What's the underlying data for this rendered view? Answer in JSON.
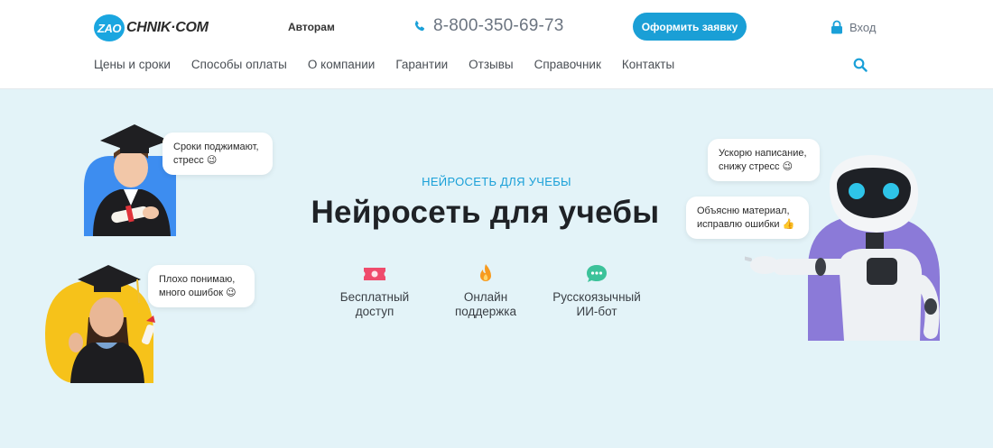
{
  "header": {
    "logo_badge": "ZAO",
    "logo_text": "CHNIK·COM",
    "authors_link": "Авторам",
    "phone": "8-800-350-69-73",
    "order_button": "Оформить заявку",
    "login": "Вход"
  },
  "nav": {
    "items": [
      "Цены и сроки",
      "Способы оплаты",
      "О компании",
      "Гарантии",
      "Отзывы",
      "Справочник",
      "Контакты"
    ]
  },
  "hero": {
    "subtitle": "НЕЙРОСЕТЬ ДЛЯ УЧЕБЫ",
    "title": "Нейросеть для учебы",
    "features": [
      {
        "label_line1": "Бесплатный",
        "label_line2": "доступ",
        "icon": "ticket-icon"
      },
      {
        "label_line1": "Онлайн",
        "label_line2": "поддержка",
        "icon": "flame-icon"
      },
      {
        "label_line1": "Русскоязычный",
        "label_line2": "ИИ-бот",
        "icon": "chat-icon"
      }
    ],
    "bubbles": {
      "student1_line1": "Сроки поджимают,",
      "student1_line2": "стресс 😉",
      "student2_line1": "Плохо понимаю,",
      "student2_line2": "много ошибок 😉",
      "robot1_line1": "Ускорю написание,",
      "robot1_line2": "снижу стресс 😉",
      "robot2_line1": "Объясню материал,",
      "robot2_line2": "исправлю ошибки 👍"
    }
  },
  "colors": {
    "brand": "#1aa6e0",
    "button": "#1a9fd6",
    "hero_bg": "#e3f3f8",
    "accent_yellow": "#f5c518",
    "accent_purple": "#8f7fe0"
  }
}
